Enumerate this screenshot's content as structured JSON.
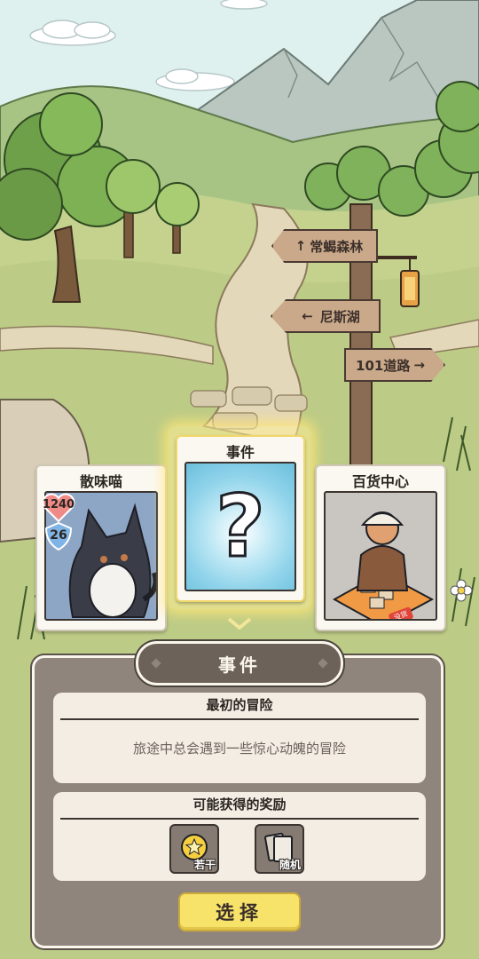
{
  "signposts": {
    "forest": "常蝎森林",
    "lake": "尼斯湖",
    "road": "101道路"
  },
  "cards": {
    "left": {
      "title": "散味喵",
      "hp": "1240",
      "attack": "26"
    },
    "center": {
      "title": "事件",
      "symbol": "?"
    },
    "right": {
      "title": "百货中心",
      "tag": "没货"
    }
  },
  "panel": {
    "tab_label": "事件",
    "event_title": "最初的冒险",
    "event_description": "旅途中总会遇到一些惊心动魄的冒险",
    "rewards_header": "可能获得的奖励",
    "rewards": [
      {
        "label": "若干",
        "icon": "coin-star-icon"
      },
      {
        "label": "随机",
        "icon": "card-stack-icon"
      }
    ],
    "choose_label": "选择"
  },
  "colors": {
    "panel_bg": "#8f857c",
    "button_yellow": "#f7e36a",
    "event_card_blue": "#8fd3ea",
    "heart_pink": "#ef8b86",
    "shield_blue": "#7fb4e6"
  }
}
